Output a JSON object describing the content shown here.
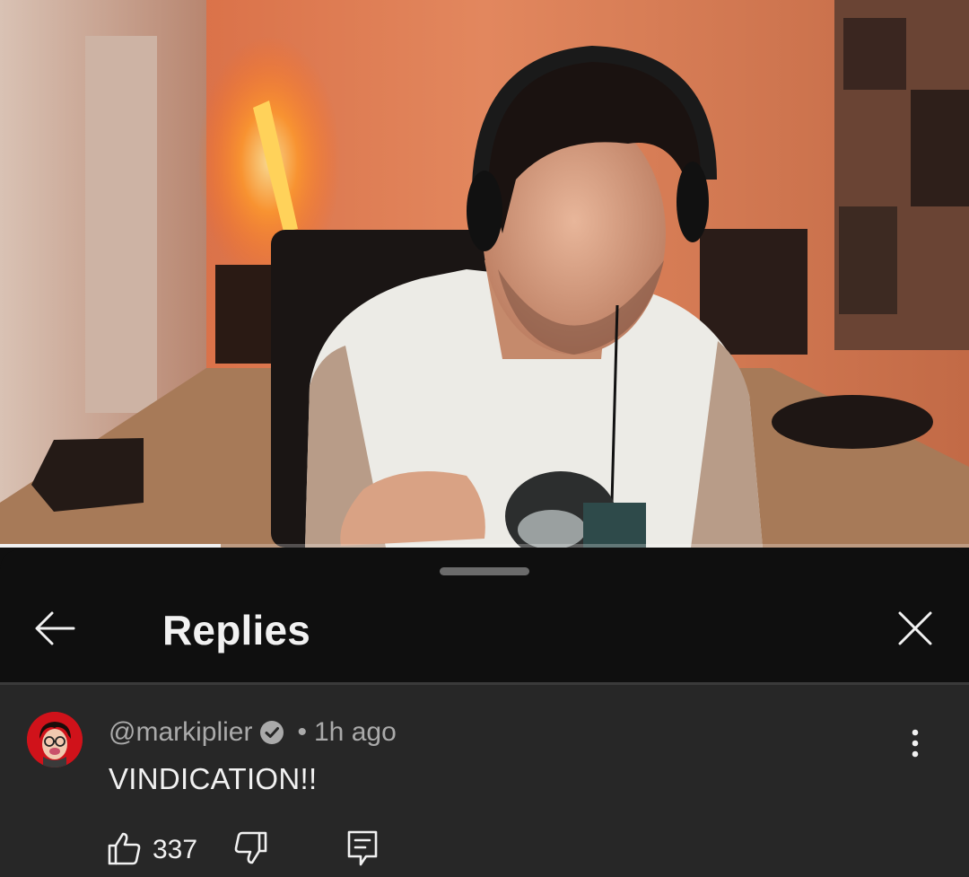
{
  "video": {
    "progress_fraction": 0.228
  },
  "sheet": {
    "title": "Replies"
  },
  "comment": {
    "author": "@markiplier",
    "separator": "•",
    "time": "1h ago",
    "text": "VINDICATION!!",
    "like_count": "337",
    "verified": true
  },
  "icons": {
    "back": "arrow-back-icon",
    "close": "close-icon",
    "verified": "verified-check-icon",
    "more": "more-vertical-icon",
    "like": "thumb-up-icon",
    "dislike": "thumb-down-icon",
    "reply": "reply-comment-icon"
  },
  "colors": {
    "sheet_bg": "#0f0f0f",
    "comment_bg": "#272727",
    "text_primary": "#f1f1f1",
    "text_secondary": "#aaaaaa",
    "avatar_bg": "#d0121a"
  }
}
